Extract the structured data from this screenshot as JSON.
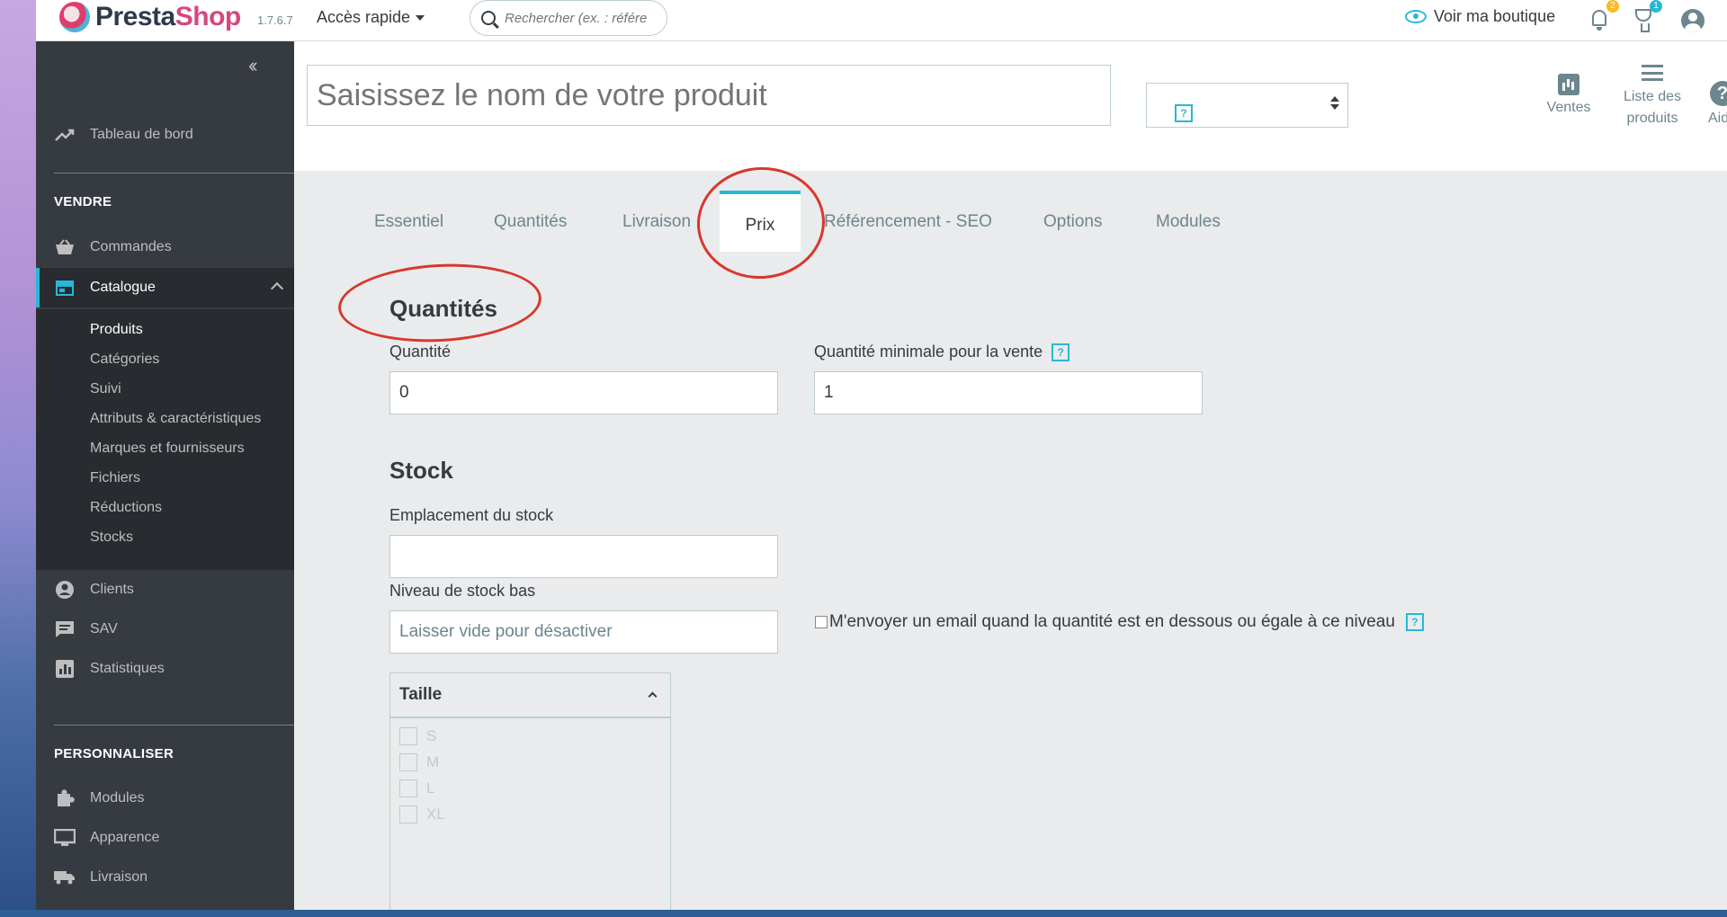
{
  "header": {
    "logo_text_a": "Presta",
    "logo_text_b": "Shop",
    "version": "1.7.6.7",
    "quick_access": "Accès rapide",
    "search_placeholder": "Rechercher (ex. : référe",
    "view_shop": "Voir ma boutique",
    "notifications_count": "2",
    "trophy_count": "1"
  },
  "sidebar": {
    "dashboard": "Tableau de bord",
    "section_sell": "VENDRE",
    "orders": "Commandes",
    "catalog": "Catalogue",
    "catalog_sub": [
      "Produits",
      "Catégories",
      "Suivi",
      "Attributs & caractéristiques",
      "Marques et fournisseurs",
      "Fichiers",
      "Réductions",
      "Stocks"
    ],
    "customers": "Clients",
    "sav": "SAV",
    "stats": "Statistiques",
    "section_customize": "PERSONNALISER",
    "modules": "Modules",
    "appearance": "Apparence",
    "shipping": "Livraison"
  },
  "product": {
    "name_placeholder": "Saisissez le nom de votre produit",
    "help_mark": "?",
    "toolbar": {
      "sales": "Ventes",
      "list_line1": "Liste des",
      "list_line2": "produits",
      "help": "Aide"
    }
  },
  "tabs": {
    "items": [
      "Essentiel",
      "Quantités",
      "Livraison",
      "Prix",
      "Référencement - SEO",
      "Options",
      "Modules"
    ],
    "active": "Prix"
  },
  "form": {
    "quantities_title": "Quantités",
    "quantity_label": "Quantité",
    "quantity_value": "0",
    "min_qty_label": "Quantité minimale pour la vente",
    "min_qty_value": "1",
    "stock_title": "Stock",
    "location_label": "Emplacement du stock",
    "location_value": "",
    "low_stock_label": "Niveau de stock bas",
    "low_stock_placeholder": "Laisser vide pour désactiver",
    "email_alert_label": "M'envoyer un email quand la quantité est en dessous ou égale à ce niveau",
    "attribute_group": "Taille",
    "attribute_values": [
      "S",
      "M",
      "L",
      "XL"
    ]
  },
  "colors": {
    "accent": "#25b9d7",
    "sidebar": "#363a41",
    "annotation": "#d7382e"
  },
  "icons": [
    "search-icon",
    "eye-icon",
    "bell-icon",
    "trophy-icon",
    "user-icon",
    "trending-up-icon",
    "basket-icon",
    "store-icon",
    "account-circle-icon",
    "chat-icon",
    "bar-chart-icon",
    "puzzle-icon",
    "monitor-icon",
    "truck-icon",
    "list-icon",
    "help-icon"
  ]
}
